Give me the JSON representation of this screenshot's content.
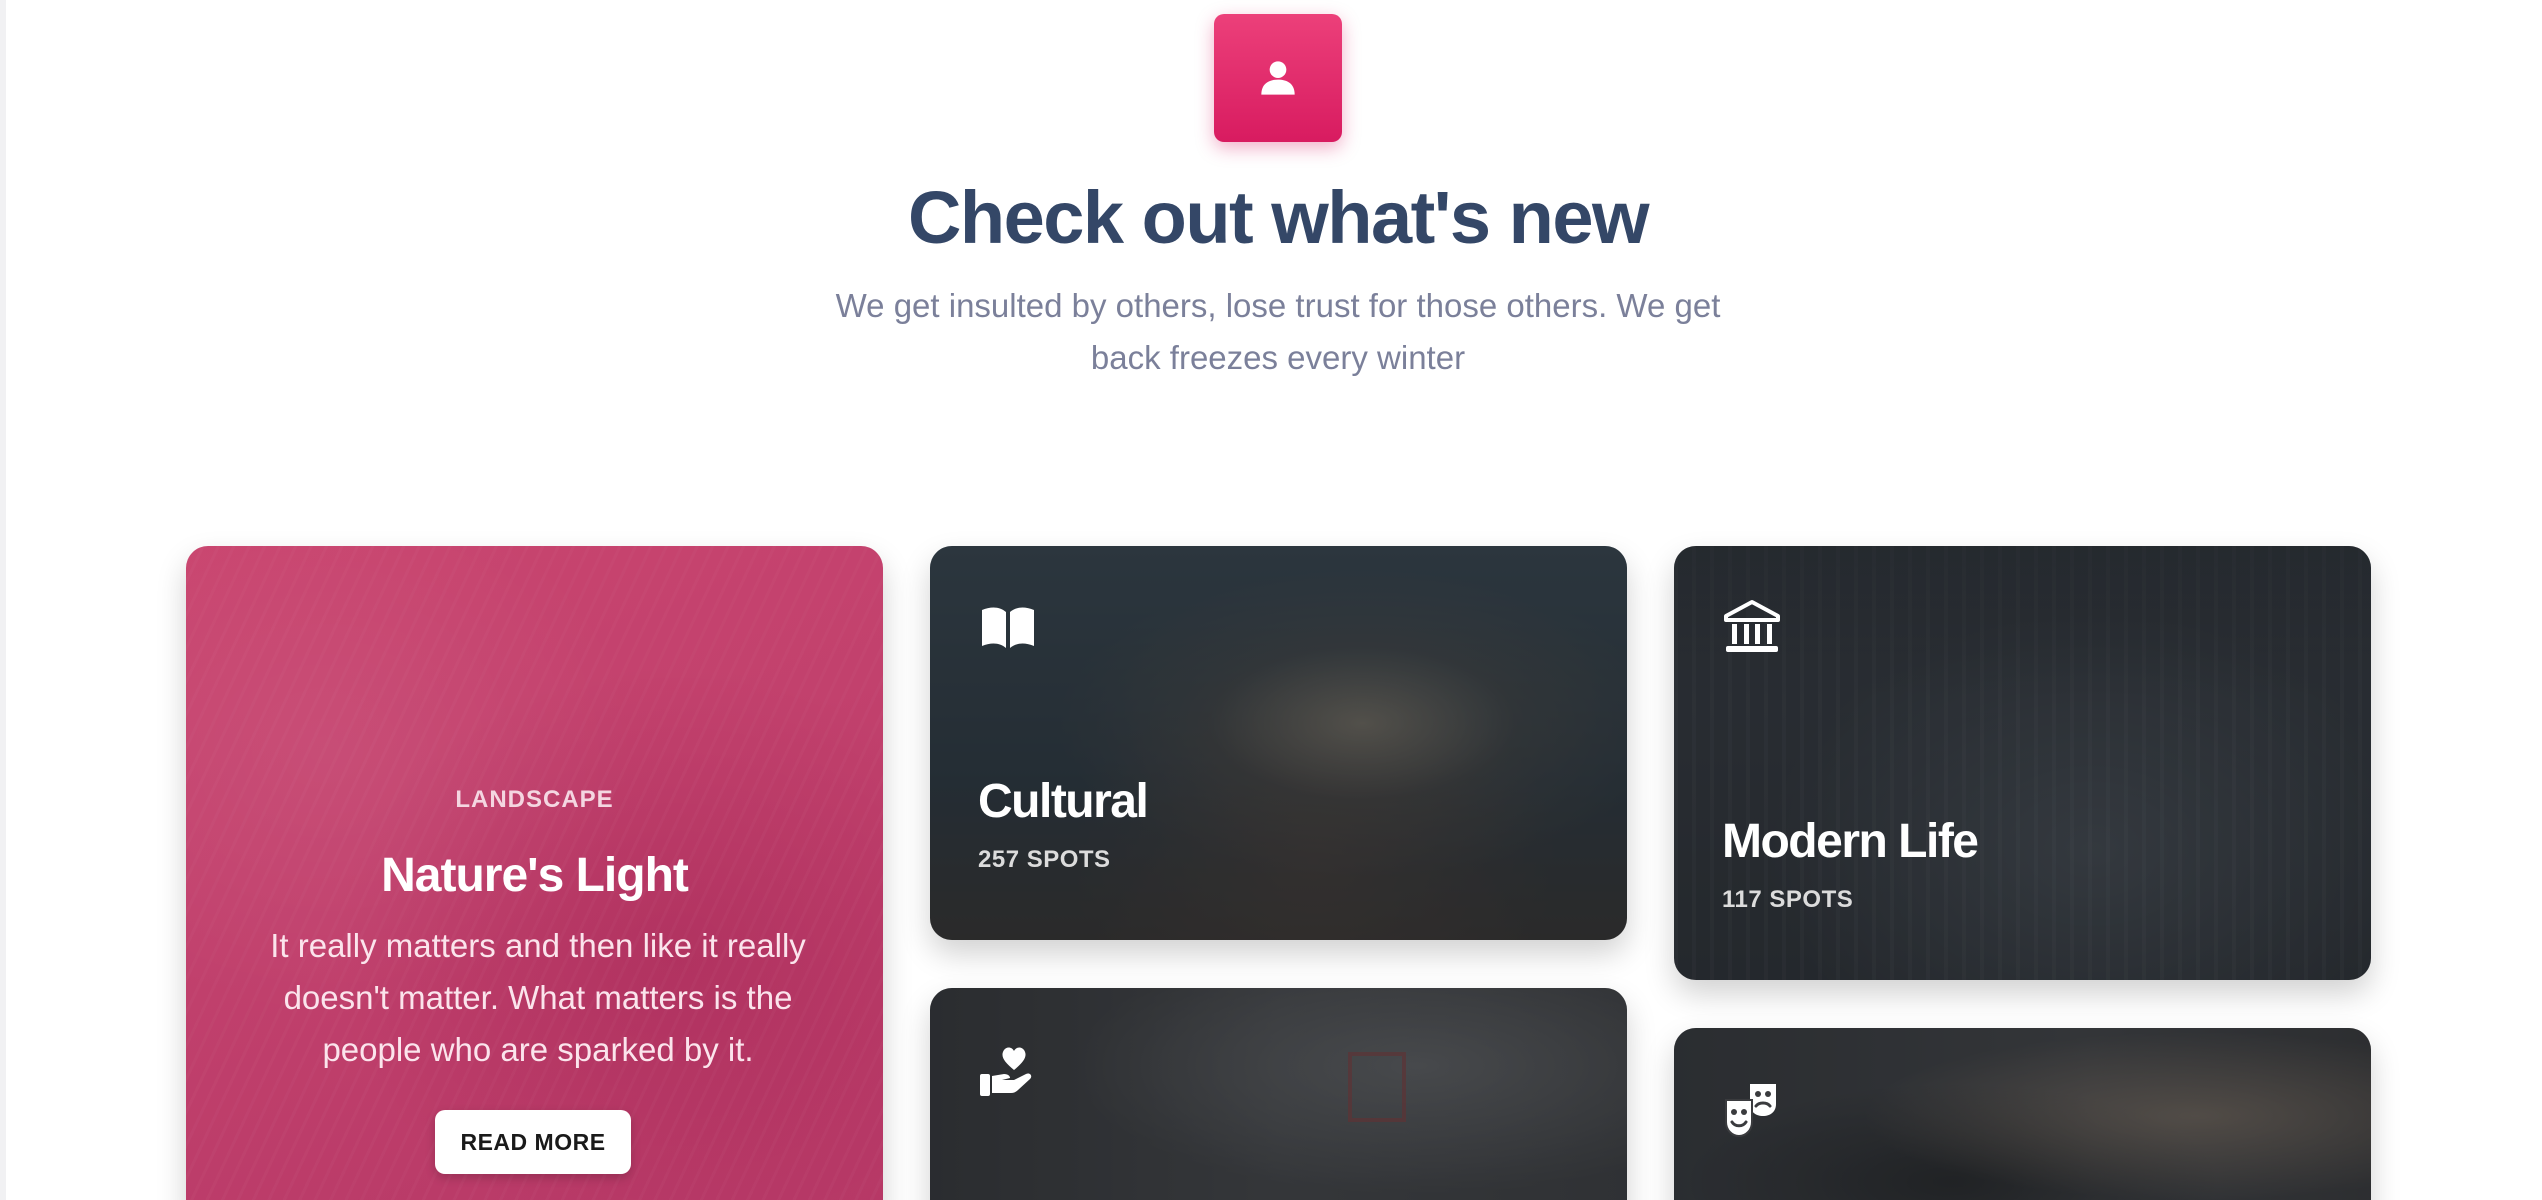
{
  "header": {
    "icon": "person-icon",
    "title": "Check out what's new",
    "subtitle": "We get insulted by others, lose trust for those others. We get back freezes every winter"
  },
  "feature_card": {
    "category": "LANDSCAPE",
    "title": "Nature's Light",
    "description": "It really matters and then like it really doesn't matter. What matters is the people who are sparked by it.",
    "button_label": "READ MORE",
    "color": "#c2416d"
  },
  "cards": [
    {
      "icon": "book-icon",
      "title": "Cultural",
      "meta": "257 SPOTS"
    },
    {
      "icon": "museum-icon",
      "title": "Modern Life",
      "meta": "117 SPOTS"
    },
    {
      "icon": "charity-hand-heart-icon",
      "title": "",
      "meta": ""
    },
    {
      "icon": "theater-masks-icon",
      "title": "",
      "meta": ""
    }
  ],
  "colors": {
    "accent": "#e91e63",
    "heading": "#344767",
    "muted_text": "#7b809a"
  }
}
